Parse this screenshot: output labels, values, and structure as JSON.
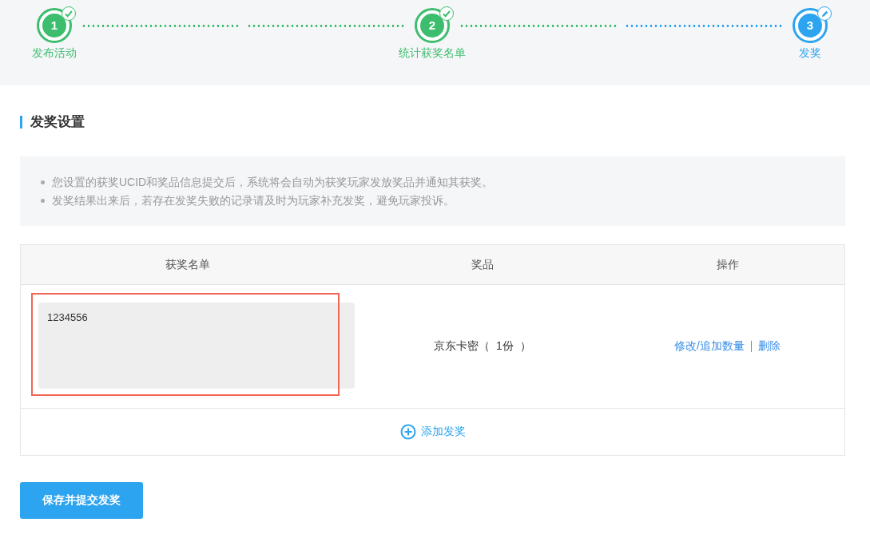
{
  "steps": [
    {
      "number": "1",
      "label": "发布活动",
      "done": true
    },
    {
      "number": "2",
      "label": "统计获奖名单",
      "done": true
    },
    {
      "number": "3",
      "label": "发奖",
      "done": false
    }
  ],
  "section_title": "发奖设置",
  "notice": [
    "您设置的获奖UCID和奖品信息提交后，系统将会自动为获奖玩家发放奖品并通知其获奖。",
    "发奖结果出来后，若存在发奖失败的记录请及时为玩家补充发奖，避免玩家投诉。"
  ],
  "table": {
    "columns": [
      "获奖名单",
      "奖品",
      "操作"
    ],
    "rows": [
      {
        "winners": "1234556",
        "highlighted": true,
        "prize": "京东卡密（  1份  ）",
        "actions": [
          "修改/追加数量",
          "删除"
        ]
      }
    ],
    "add_label": "添加发奖"
  },
  "submit_button": "保存并提交发奖"
}
